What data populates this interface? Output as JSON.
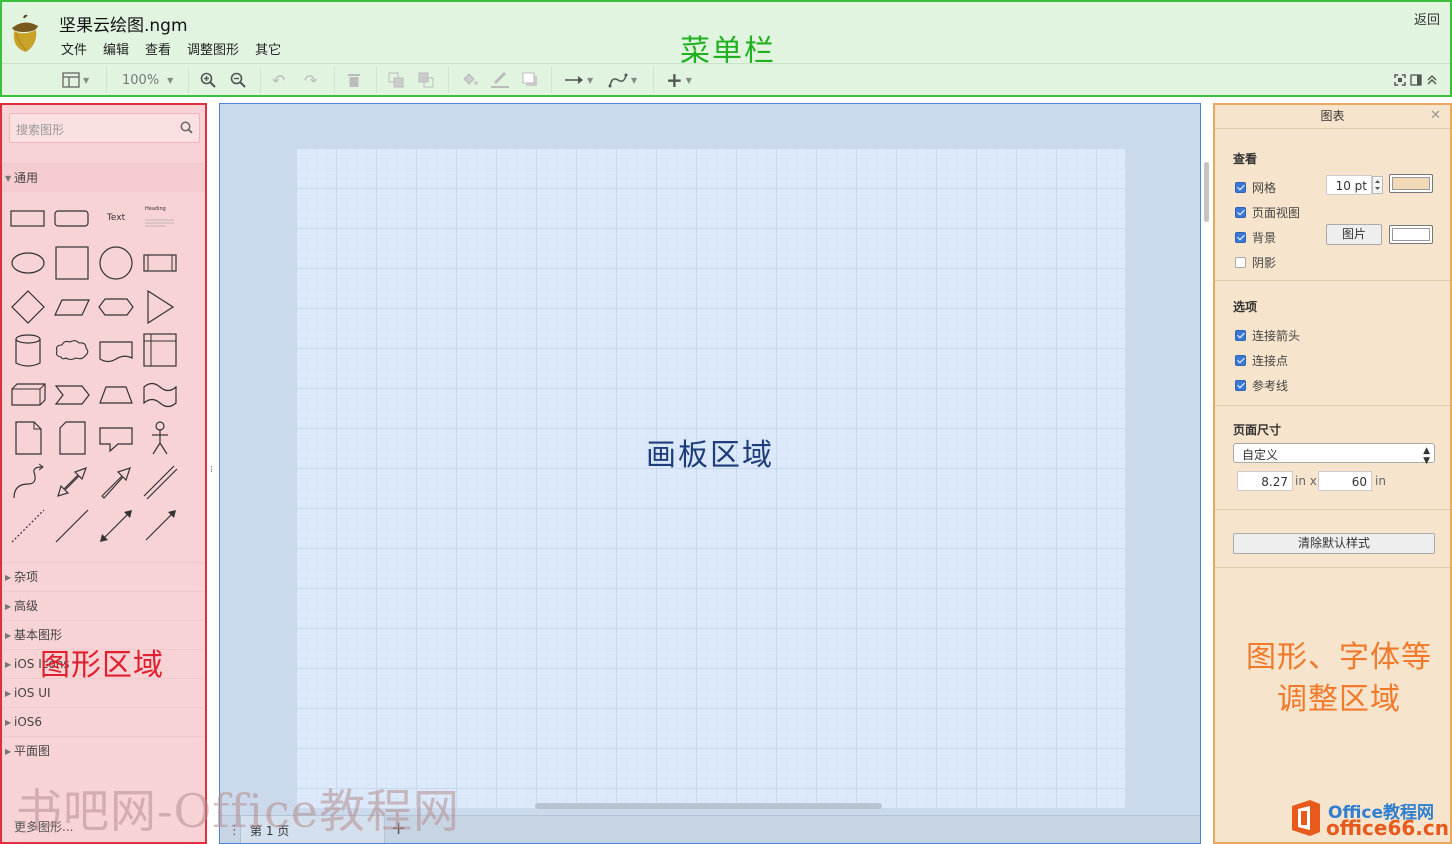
{
  "app": {
    "document_title": "坚果云绘图.ngm",
    "back_label": "返回",
    "menus": [
      "文件",
      "编辑",
      "查看",
      "调整图形",
      "其它"
    ],
    "zoom_level": "100%"
  },
  "annotations": {
    "menu_region": "菜单栏",
    "shapes_region": "图形区域",
    "canvas_region": "画板区域",
    "format_region_line1": "图形、字体等",
    "format_region_line2": "调整区域"
  },
  "shapes_panel": {
    "search_placeholder": "搜索图形",
    "general_category": "通用",
    "text_shape_label": "Text",
    "heading_shape_label": "Heading",
    "categories": [
      "杂项",
      "高级",
      "基本图形",
      "iOS Icons",
      "iOS UI",
      "iOS6",
      "平面图"
    ],
    "more_shapes": "更多图形..."
  },
  "canvas": {
    "page_tab": "第 1 页",
    "add_page": "+"
  },
  "format_panel": {
    "title": "图表",
    "view_section": "查看",
    "view_options": [
      {
        "label": "网格",
        "checked": true
      },
      {
        "label": "页面视图",
        "checked": true
      },
      {
        "label": "背景",
        "checked": true
      },
      {
        "label": "阴影",
        "checked": false
      }
    ],
    "grid_size": "10 pt",
    "image_button": "图片",
    "options_section": "选项",
    "options": [
      {
        "label": "连接箭头",
        "checked": true
      },
      {
        "label": "连接点",
        "checked": true
      },
      {
        "label": "参考线",
        "checked": true
      }
    ],
    "page_size_section": "页面尺寸",
    "page_size_value": "自定义",
    "width_value": "8.27",
    "width_unit": "in x",
    "height_value": "60",
    "height_unit": "in",
    "clear_style_button": "清除默认样式"
  },
  "watermarks": {
    "site_text": "书吧网-Office教程网",
    "logo_line1": "Office教程网",
    "logo_line2": "office66.cn"
  },
  "colors": {
    "menu_region": "#3cbf3c",
    "shapes_region": "#e03040",
    "canvas_region": "#4a86d8",
    "format_region": "#e8a860",
    "checkbox": "#3b79d6"
  }
}
